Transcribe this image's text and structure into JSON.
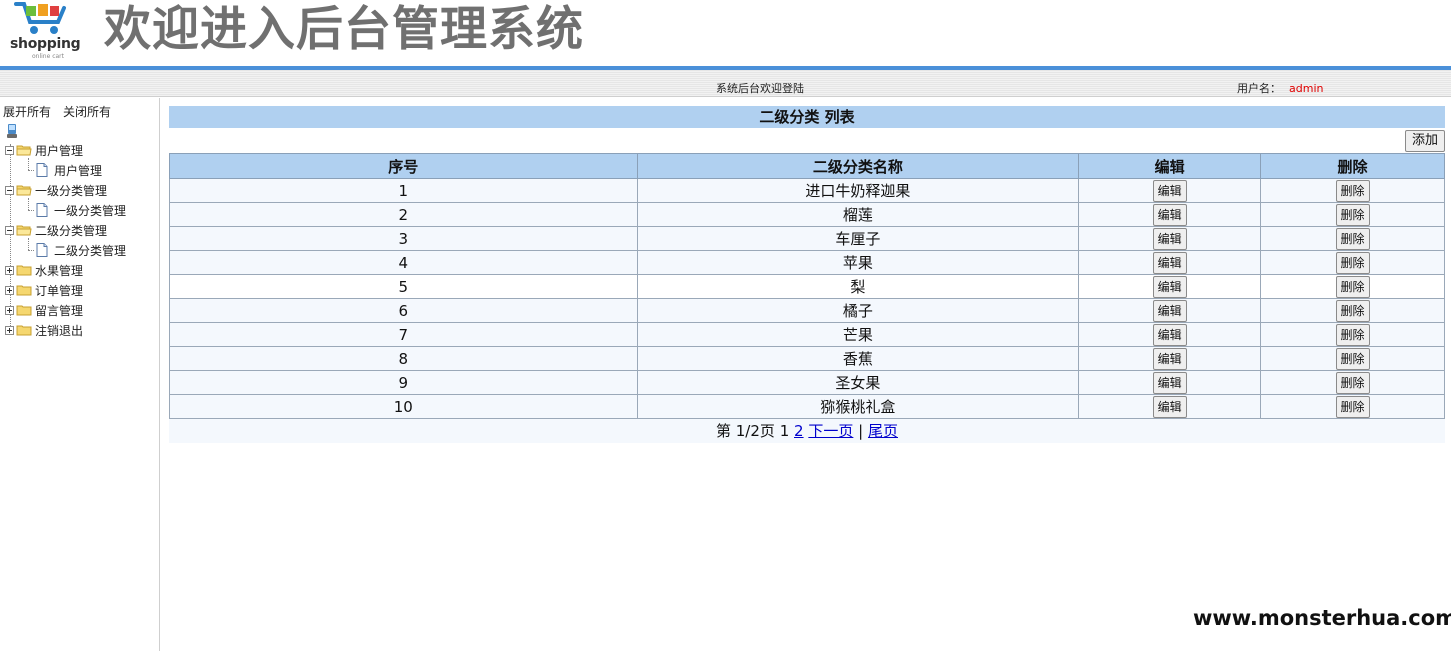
{
  "header": {
    "logo_text": "shopping",
    "logo_sub": "online cart",
    "title": "欢迎进入后台管理系统"
  },
  "status": {
    "center_text": "系统后台欢迎登陆",
    "user_label": "用户名：",
    "user_name": "admin"
  },
  "sidebar": {
    "expand_all": "展开所有",
    "collapse_all": "关闭所有",
    "nodes": [
      {
        "label": "用户管理",
        "expanded": true,
        "child": "用户管理"
      },
      {
        "label": "一级分类管理",
        "expanded": true,
        "child": "一级分类管理"
      },
      {
        "label": "二级分类管理",
        "expanded": true,
        "child": "二级分类管理"
      },
      {
        "label": "水果管理",
        "expanded": false
      },
      {
        "label": "订单管理",
        "expanded": false
      },
      {
        "label": "留言管理",
        "expanded": false
      },
      {
        "label": "注销退出",
        "expanded": false
      }
    ]
  },
  "main": {
    "title": "二级分类 列表",
    "add_label": "添加",
    "columns": [
      "序号",
      "二级分类名称",
      "编辑",
      "删除"
    ],
    "edit_label": "编辑",
    "delete_label": "删除",
    "rows": [
      {
        "id": "1",
        "name": "进口牛奶释迦果"
      },
      {
        "id": "2",
        "name": "榴莲"
      },
      {
        "id": "3",
        "name": "车厘子"
      },
      {
        "id": "4",
        "name": "苹果"
      },
      {
        "id": "5",
        "name": "梨"
      },
      {
        "id": "6",
        "name": "橘子"
      },
      {
        "id": "7",
        "name": "芒果"
      },
      {
        "id": "8",
        "name": "香蕉"
      },
      {
        "id": "9",
        "name": "圣女果"
      },
      {
        "id": "10",
        "name": "猕猴桃礼盒"
      }
    ],
    "pager": {
      "info": "第 1/2页",
      "current_page": "1",
      "page2": "2",
      "next": "下一页",
      "sep": "|",
      "last": "尾页"
    }
  },
  "watermark": "www.monsterhua.com",
  "colors": {
    "accent_line": "#4a90d9",
    "header_blue": "#b0d0f0",
    "username_red": "#e00000",
    "link_blue": "#0000cc"
  }
}
